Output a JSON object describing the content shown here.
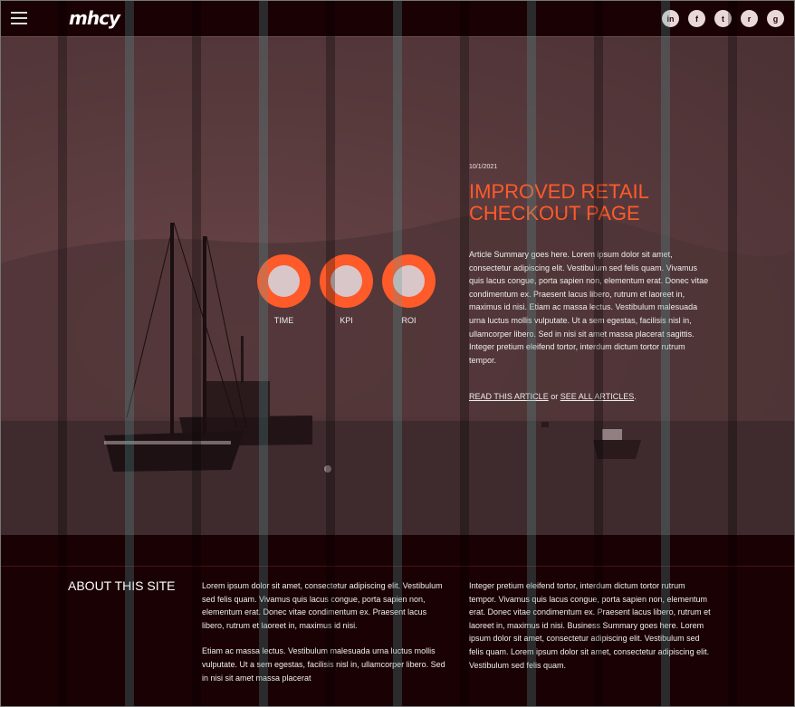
{
  "header": {
    "logo_text": "mhcy",
    "menu_icon": "hamburger-icon",
    "social": [
      {
        "name": "linkedin-icon",
        "glyph": "in"
      },
      {
        "name": "facebook-icon",
        "glyph": "f"
      },
      {
        "name": "twitter-icon",
        "glyph": "t"
      },
      {
        "name": "reddit-icon",
        "glyph": "r"
      },
      {
        "name": "github-icon",
        "glyph": "g"
      }
    ]
  },
  "metrics": [
    {
      "label": "TIME"
    },
    {
      "label": "KPI"
    },
    {
      "label": "ROI"
    }
  ],
  "article": {
    "date": "10/1/2021",
    "title": "IMPROVED RETAIL CHECKOUT PAGE",
    "summary": "Article Summary goes here. Lorem ipsum dolor sit amet, consectetur adipiscing elit. Vestibulum sed felis quam. Vivamus quis lacus congue, porta sapien non, elementum erat. Donec vitae condimentum ex. Praesent lacus libero, rutrum et laoreet in, maximus id nisi. Etiam ac massa lectus. Vestibulum malesuada urna luctus mollis vulputate. Ut a sem egestas, facilisis nisl in, ullamcorper libero. Sed in nisi sit amet massa placerat sagittis. Integer pretium eleifend tortor, interdum dictum tortor rutrum tempor.",
    "read_link": "READ THIS ARTICLE",
    "or_text": " or ",
    "all_link": "SEE ALL ARTICLES",
    "end_text": "."
  },
  "footer": {
    "heading": "ABOUT THIS SITE",
    "col1_p1": "Lorem ipsum dolor sit amet, consectetur adipiscing elit. Vestibulum sed felis quam. Vivamus quis lacus congue, porta sapien non, elementum erat. Donec vitae condimentum ex. Praesent lacus libero, rutrum et laoreet in, maximus id nisi.",
    "col1_p2": "Etiam ac massa lectus. Vestibulum malesuada urna luctus mollis vulputate. Ut a sem egestas, facilisis nisl in, ullamcorper libero. Sed in nisi sit amet massa placerat",
    "col2": "Integer pretium eleifend tortor, interdum dictum tortor rutrum tempor. Vivamus quis lacus congue, porta sapien non, elementum erat. Donec vitae condimentum ex. Praesent lacus libero, rutrum et laoreet in, maximus id nisi. Business Summary goes here. Lorem ipsum dolor sit amet, consectetur adipiscing elit. Vestibulum sed felis quam. Lorem ipsum dolor sit amet, consectetur adipiscing elit. Vestibulum sed felis quam."
  },
  "colors": {
    "accent": "#ff5a2a",
    "background": "#1a0103",
    "hero_tint": "#5a3b3e"
  }
}
